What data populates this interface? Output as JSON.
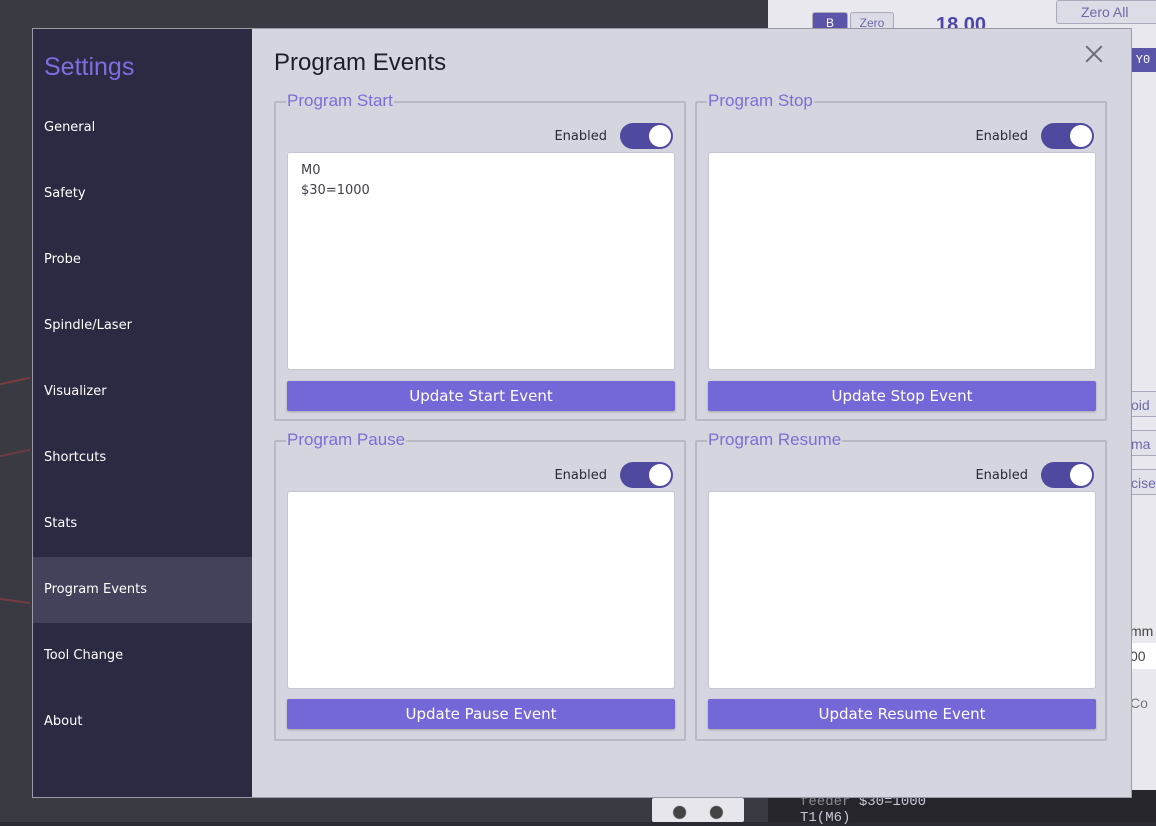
{
  "background": {
    "zero_all_label": "Zero All",
    "b_label": "B",
    "zero_label": "Zero",
    "coord_value": "18.00",
    "y0_label": "Y0",
    "side_tabs": [
      "oid",
      "ma",
      "cise",
      "mm",
      "00",
      "Co"
    ],
    "code_lines": [
      {
        "prefix": "feeder",
        "value": "$30=1000"
      },
      {
        "prefix": "T1(M6)",
        "value": ""
      }
    ]
  },
  "settings": {
    "title": "Settings",
    "nav_items": [
      {
        "label": "General"
      },
      {
        "label": "Safety"
      },
      {
        "label": "Probe"
      },
      {
        "label": "Spindle/Laser"
      },
      {
        "label": "Visualizer"
      },
      {
        "label": "Shortcuts"
      },
      {
        "label": "Stats"
      },
      {
        "label": "Program Events",
        "active": true
      },
      {
        "label": "Tool Change"
      },
      {
        "label": "About"
      }
    ]
  },
  "main": {
    "page_title": "Program Events",
    "enabled_label": "Enabled",
    "events": {
      "start": {
        "legend": "Program Start",
        "enabled": true,
        "code": "M0\n$30=1000",
        "button": "Update Start Event"
      },
      "stop": {
        "legend": "Program Stop",
        "enabled": true,
        "code": "",
        "button": "Update Stop Event"
      },
      "pause": {
        "legend": "Program Pause",
        "enabled": true,
        "code": "",
        "button": "Update Pause Event"
      },
      "resume": {
        "legend": "Program Resume",
        "enabled": true,
        "code": "",
        "button": "Update Resume Event"
      }
    }
  },
  "colors": {
    "accent": "#7468d8",
    "toggle_on": "#4f4aa0",
    "sidebar_bg": "#2b2a43",
    "content_bg": "#d5d5e0"
  }
}
